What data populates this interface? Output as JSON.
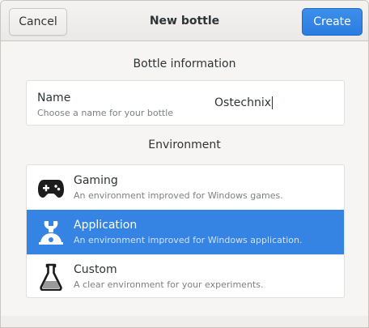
{
  "header": {
    "cancel_label": "Cancel",
    "title": "New bottle",
    "create_label": "Create"
  },
  "bottle_info": {
    "section_title": "Bottle information",
    "name_label": "Name",
    "name_hint": "Choose a name for your bottle",
    "name_value": "Ostechnix"
  },
  "environment": {
    "section_title": "Environment",
    "selected": "Application",
    "items": [
      {
        "title": "Gaming",
        "description": "An environment improved for Windows games.",
        "icon": "gamepad-icon"
      },
      {
        "title": "Application",
        "description": "An environment improved for Windows application.",
        "icon": "wrench-icon"
      },
      {
        "title": "Custom",
        "description": "A clear environment for your experiments.",
        "icon": "flask-icon"
      }
    ]
  },
  "colors": {
    "accent": "#3584e4",
    "text": "#2e3436",
    "subtext": "#7d8180"
  }
}
